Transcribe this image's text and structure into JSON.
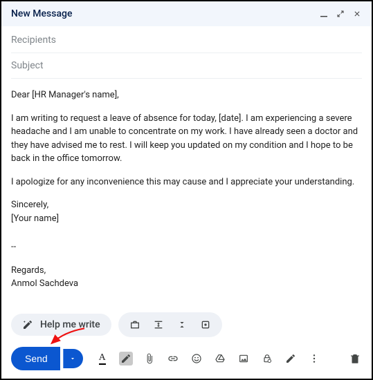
{
  "header": {
    "title": "New Message"
  },
  "fields": {
    "recipients_placeholder": "Recipients",
    "subject_placeholder": "Subject"
  },
  "body": {
    "greeting": "Dear [HR Manager's name],",
    "p1": "I am writing to request a leave of absence for today, [date]. I am experiencing a severe headache and I am unable to concentrate on my work. I have already seen a doctor and they have advised me to rest. I will keep you updated on my condition and I hope to be back in the office tomorrow.",
    "p2": "I apologize for any inconvenience this may cause and I appreciate your understanding.",
    "closing": "Sincerely,",
    "sender_placeholder": "[Your name]",
    "sig_sep": "--",
    "sig_regards": "Regards,",
    "sig_name": "Anmol Sachdeva"
  },
  "help": {
    "label": "Help me write"
  },
  "toolbar": {
    "send_label": "Send"
  }
}
